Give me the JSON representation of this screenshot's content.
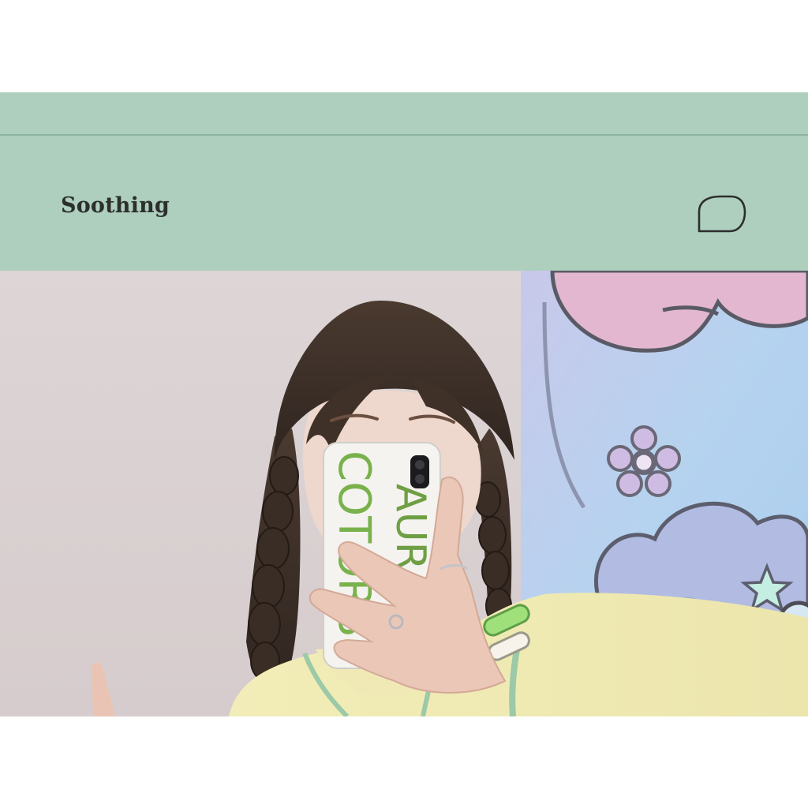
{
  "header": {
    "title": "Soothing",
    "message_icon": "speech-bubble-icon"
  },
  "photo": {
    "phone_case_text_left": "COTORS",
    "phone_case_text_right": "AURA"
  },
  "colors": {
    "header_bg": "#aecfbd",
    "header_divider": "#8fb3a1",
    "title_text": "#2c2f2e",
    "page_bg": "#ffffff"
  }
}
